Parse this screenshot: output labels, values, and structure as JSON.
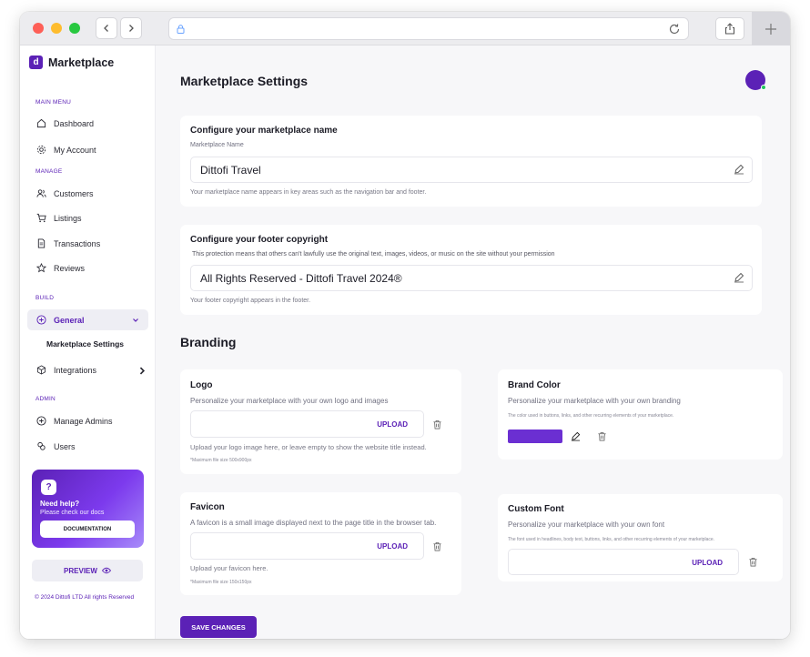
{
  "brand": {
    "name": "Marketplace",
    "logo_letter": "d",
    "accent": "#5b21b6"
  },
  "sidebar": {
    "main_menu_label": "MAIN MENU",
    "main_menu": [
      {
        "label": "Dashboard",
        "icon": "home-icon"
      },
      {
        "label": "My Account",
        "icon": "gear-icon"
      }
    ],
    "manage_label": "MANAGE",
    "manage": [
      {
        "label": "Customers",
        "icon": "users-icon"
      },
      {
        "label": "Listings",
        "icon": "cart-icon"
      },
      {
        "label": "Transactions",
        "icon": "document-icon"
      },
      {
        "label": "Reviews",
        "icon": "star-icon"
      }
    ],
    "build_label": "BUILD",
    "general": {
      "label": "General",
      "icon": "plus-circle-icon"
    },
    "general_sub": "Marketplace Settings",
    "integrations": {
      "label": "Integrations",
      "icon": "cube-icon"
    },
    "admin_label": "ADMIN",
    "admin": [
      {
        "label": "Manage Admins",
        "icon": "plus-circle-icon"
      },
      {
        "label": "Users",
        "icon": "users-icon"
      }
    ],
    "help": {
      "title": "Need help?",
      "subtitle": "Please check our docs",
      "button": "DOCUMENTATION"
    },
    "preview_label": "PREVIEW",
    "copyright": "© 2024 Dittofi LTD All rights Reserved"
  },
  "main": {
    "title": "Marketplace Settings",
    "name_card": {
      "title": "Configure your marketplace name",
      "field_label": "Marketplace Name",
      "value": "Dittofi Travel",
      "helper": "Your marketplace name appears in key areas such as the navigation bar and footer."
    },
    "footer_card": {
      "title": "Configure your footer copyright",
      "description": "This protection means that others can't lawfully use the original text, images, videos, or music on the site without your permission",
      "value": "All Rights Reserved - Dittofi Travel 2024®",
      "helper": "Your footer copyright appears in the footer."
    },
    "branding_title": "Branding",
    "logo_card": {
      "title": "Logo",
      "subtitle": "Personalize your marketplace with your own logo and images",
      "upload": "UPLOAD",
      "helper": "Upload your logo image here, or leave empty to show the website title instead.",
      "note": "*Maximum file size 500x900px"
    },
    "brand_color_card": {
      "title": "Brand Color",
      "subtitle": "Personalize your marketplace with your own branding",
      "note": "The color used in buttons, links, and other recurring elements of your marketplace.",
      "color": "#6b2fd2"
    },
    "favicon_card": {
      "title": "Favicon",
      "subtitle": "A favicon is a small image displayed next to the page title in the browser tab.",
      "upload": "UPLOAD",
      "helper": "Upload your favicon here.",
      "note": "*Maximum file size 150x150px"
    },
    "font_card": {
      "title": "Custom Font",
      "subtitle": "Personalize your marketplace with your own font",
      "note": "The font used in headlines, body text, buttons, links, and other recurring elements of your marketplace.",
      "upload": "UPLOAD"
    },
    "save_label": "SAVE CHANGES"
  }
}
